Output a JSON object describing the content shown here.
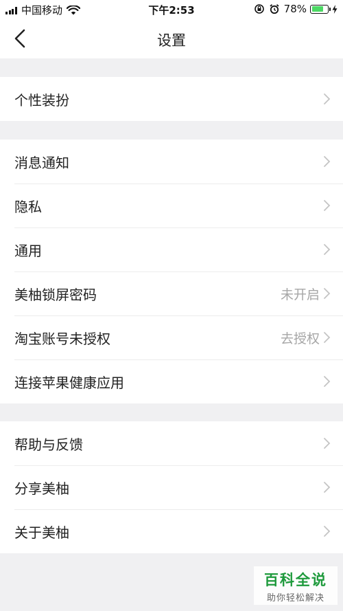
{
  "status_bar": {
    "carrier": "中国移动",
    "time": "下午2:53",
    "battery_percent": "78%",
    "battery_level": 0.78,
    "icons": [
      "signal-icon",
      "wifi-icon",
      "orientation-lock-icon",
      "alarm-icon",
      "battery-icon",
      "charging-bolt-icon"
    ]
  },
  "header": {
    "title": "设置",
    "back_icon": "chevron-left-icon"
  },
  "groups": [
    {
      "items": [
        {
          "label": "个性装扮",
          "value": ""
        }
      ]
    },
    {
      "items": [
        {
          "label": "消息通知",
          "value": ""
        },
        {
          "label": "隐私",
          "value": ""
        },
        {
          "label": "通用",
          "value": ""
        },
        {
          "label": "美柚锁屏密码",
          "value": "未开启"
        },
        {
          "label": "淘宝账号未授权",
          "value": "去授权"
        },
        {
          "label": "连接苹果健康应用",
          "value": ""
        }
      ]
    },
    {
      "items": [
        {
          "label": "帮助与反馈",
          "value": ""
        },
        {
          "label": "分享美柚",
          "value": ""
        },
        {
          "label": "关于美柚",
          "value": ""
        }
      ]
    }
  ],
  "watermark": {
    "title": "百科全说",
    "subtitle": "助你轻松解决"
  },
  "colors": {
    "background": "#f0f0f2",
    "battery_fill": "#4cd964",
    "watermark_green": "#1e9a3c",
    "secondary_text": "#a6a6a6"
  }
}
